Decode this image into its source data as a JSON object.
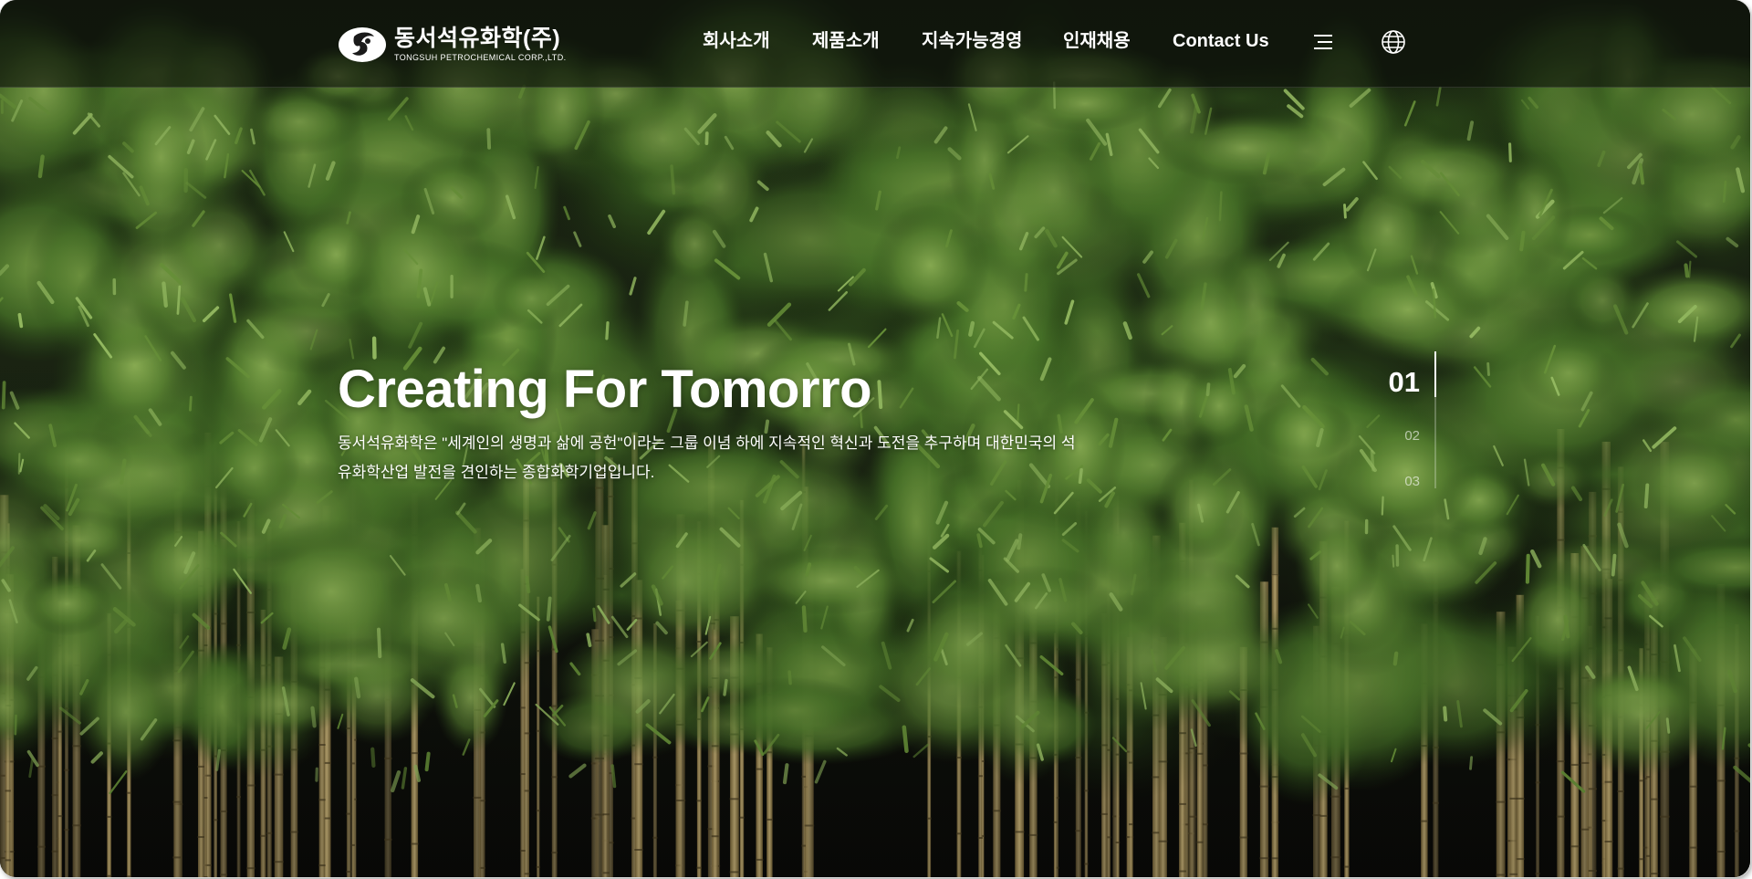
{
  "header": {
    "logo": {
      "name_ko": "동서석유화학(주)",
      "name_en": "TONGSUH PETROCHEMICAL CORP.,LTD."
    },
    "nav": [
      {
        "label": "회사소개"
      },
      {
        "label": "제품소개"
      },
      {
        "label": "지속가능경영"
      },
      {
        "label": "인재채용"
      },
      {
        "label": "Contact Us"
      }
    ],
    "icons": {
      "menu": "hamburger-icon",
      "language": "globe-icon"
    }
  },
  "hero": {
    "title": "Creating For Tomorro",
    "description": "동서석유화학은 \"세계인의 생명과 삶에 공헌\"이라는 그룹 이념 하에 지속적인 혁신과 도전을 추구하며 대한민국의 석유화학산업 발전을 견인하는 종합화학기업입니다."
  },
  "pager": {
    "slides": [
      "01",
      "02",
      "03"
    ],
    "active": "01"
  },
  "colors": {
    "header_bg": "#0c0e0a",
    "text": "#ffffff",
    "foliage": "#4f7a2c",
    "stalk": "#b8a36a"
  }
}
